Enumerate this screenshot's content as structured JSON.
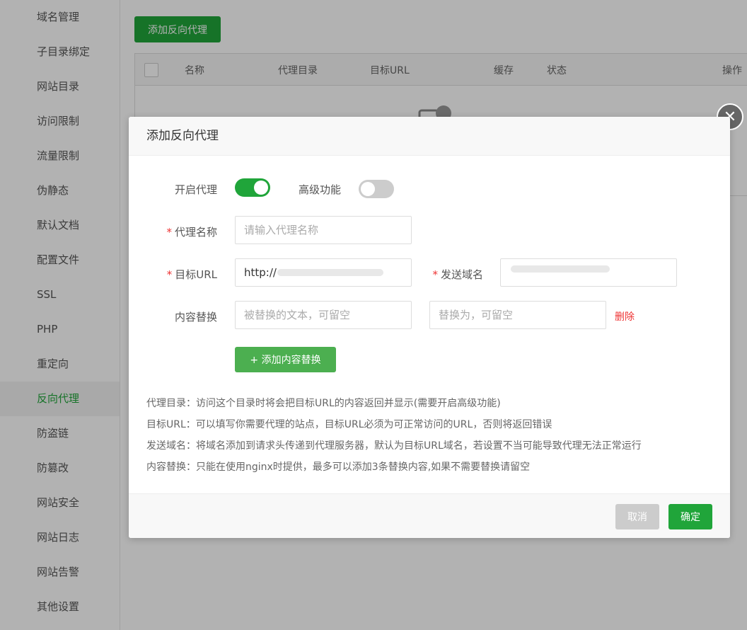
{
  "sidebar": {
    "items": [
      {
        "label": "域名管理"
      },
      {
        "label": "子目录绑定"
      },
      {
        "label": "网站目录"
      },
      {
        "label": "访问限制"
      },
      {
        "label": "流量限制"
      },
      {
        "label": "伪静态"
      },
      {
        "label": "默认文档"
      },
      {
        "label": "配置文件"
      },
      {
        "label": "SSL"
      },
      {
        "label": "PHP"
      },
      {
        "label": "重定向"
      },
      {
        "label": "反向代理"
      },
      {
        "label": "防盗链"
      },
      {
        "label": "防篡改"
      },
      {
        "label": "网站安全"
      },
      {
        "label": "网站日志"
      },
      {
        "label": "网站告警"
      },
      {
        "label": "其他设置"
      }
    ],
    "active": "反向代理"
  },
  "main": {
    "add_button_label": "添加反向代理",
    "table_headers": {
      "name": "名称",
      "proxy_dir": "代理目录",
      "target_url": "目标URL",
      "cache": "缓存",
      "status": "状态",
      "actions": "操作"
    }
  },
  "modal": {
    "title": "添加反向代理",
    "enable_proxy_label": "开启代理",
    "enable_proxy_on": true,
    "advanced_label": "高级功能",
    "advanced_on": false,
    "required_mark": "*",
    "proxy_name_label": "代理名称",
    "proxy_name_placeholder": "请输入代理名称",
    "target_url_label": "目标URL",
    "target_url_value": "http://",
    "send_domain_label": "发送域名",
    "content_replace_label": "内容替换",
    "replace_from_placeholder": "被替换的文本，可留空",
    "replace_to_placeholder": "替换为，可留空",
    "delete_label": "删除",
    "add_replace_label": "添加内容替换",
    "add_replace_icon": "+",
    "help_lines": [
      "代理目录：访问这个目录时将会把目标URL的内容返回并显示(需要开启高级功能)",
      "目标URL：可以填写你需要代理的站点，目标URL必须为可正常访问的URL，否则将返回错误",
      "发送域名：将域名添加到请求头传递到代理服务器，默认为目标URL域名，若设置不当可能导致代理无法正常运行",
      "内容替换：只能在使用nginx时提供，最多可以添加3条替换内容,如果不需要替换请留空"
    ],
    "cancel_label": "取消",
    "ok_label": "确定",
    "close_icon": "✕"
  },
  "colors": {
    "accent": "#20a53a",
    "danger": "#e33333",
    "toggle_off": "#cccccc"
  }
}
